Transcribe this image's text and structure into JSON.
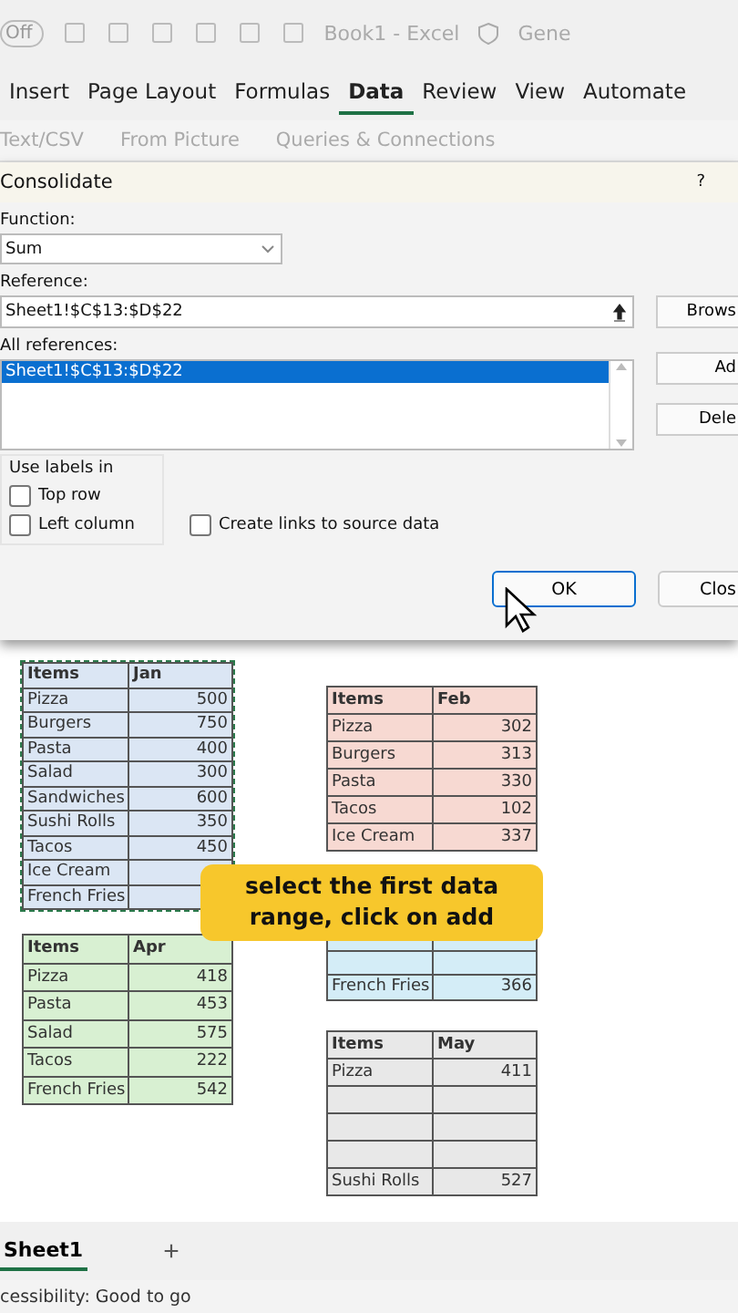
{
  "title_bar": {
    "autosave": "Off",
    "title": "Book1 - Excel",
    "sensitivity": "Gene"
  },
  "ribbon_tabs": [
    {
      "label": "Insert",
      "selected": false
    },
    {
      "label": "Page Layout",
      "selected": false
    },
    {
      "label": "Formulas",
      "selected": false
    },
    {
      "label": "Data",
      "selected": true
    },
    {
      "label": "Review",
      "selected": false
    },
    {
      "label": "View",
      "selected": false
    },
    {
      "label": "Automate",
      "selected": false
    }
  ],
  "ribbon": {
    "items": [
      "Text/CSV",
      "From Picture",
      "Queries & Connections"
    ]
  },
  "dialog": {
    "title": "Consolidate",
    "help": "?",
    "function_label": "Function:",
    "function_value": "Sum",
    "reference_label": "Reference:",
    "reference_value": "Sheet1!$C$13:$D$22",
    "all_references_label": "All references:",
    "all_references": [
      {
        "label": "Sheet1!$C$13:$D$22",
        "selected": true
      }
    ],
    "side_buttons": [
      "Brows",
      "Ad",
      "Dele"
    ],
    "use_labels_title": "Use labels in",
    "checkboxes": [
      {
        "label": "Top row",
        "checked": false
      },
      {
        "label": "Left column",
        "checked": false
      },
      {
        "label": "Create links to source data",
        "checked": false
      }
    ],
    "ok": "OK",
    "close": "Clos"
  },
  "sheet": {
    "left_column": [
      {
        "color": "#dbe6f4",
        "selected": true,
        "header": [
          "Items",
          "Jan"
        ],
        "rows": [
          {
            "kind": "row",
            "item": "Pizza",
            "value": "500"
          },
          {
            "kind": "row",
            "item": "Burgers",
            "value": "750"
          },
          {
            "kind": "row",
            "item": "Pasta",
            "value": "400"
          },
          {
            "kind": "row",
            "item": "Salad",
            "value": "300"
          },
          {
            "kind": "row",
            "item": "Sandwiches",
            "value": "600"
          },
          {
            "kind": "row",
            "item": "Sushi Rolls",
            "value": "350"
          },
          {
            "kind": "row",
            "item": "Tacos",
            "value": "450"
          },
          {
            "kind": "row",
            "item": "Ice Cream"
          },
          {
            "kind": "row",
            "item": "French Fries"
          }
        ]
      },
      {
        "color": "#d8f0d2",
        "selected": false,
        "header": [
          "Items",
          "Apr"
        ],
        "rows": [
          {
            "kind": "row",
            "item": "Pizza",
            "value": "418"
          },
          {
            "kind": "row",
            "item": "Pasta",
            "value": "453"
          },
          {
            "kind": "row",
            "item": "Salad",
            "value": "575"
          },
          {
            "kind": "row",
            "item": "Tacos",
            "value": "222"
          },
          {
            "kind": "row",
            "item": "French Fries",
            "value": "542"
          }
        ]
      }
    ],
    "right_column": [
      {
        "color": "#f7d9d2",
        "selected": false,
        "header": [
          "Items",
          "Feb"
        ],
        "rows": [
          {
            "kind": "row",
            "item": "Pizza",
            "value": "302"
          },
          {
            "kind": "row",
            "item": "Burgers",
            "value": "313"
          },
          {
            "kind": "row",
            "item": "Pasta",
            "value": "330"
          },
          {
            "kind": "row",
            "item": "Tacos",
            "value": "102"
          },
          {
            "kind": "row",
            "item": "Ice Cream",
            "value": "337"
          }
        ]
      },
      {
        "color": "#d4edf7",
        "selected": false,
        "rows": [
          {
            "kind": "blank"
          },
          {
            "kind": "blank"
          },
          {
            "kind": "row",
            "item": "French Fries",
            "value": "366"
          }
        ]
      },
      {
        "color": "#e8e8e8",
        "selected": false,
        "header": [
          "Items",
          "May"
        ],
        "rows": [
          {
            "kind": "row",
            "item": "Pizza",
            "value": "411"
          },
          {
            "kind": "blank"
          },
          {
            "kind": "blank"
          },
          {
            "kind": "blank"
          },
          {
            "kind": "row",
            "item": "Sushi Rolls",
            "value": "527"
          }
        ]
      }
    ]
  },
  "caption": "select the first data range, click on add",
  "sheet_tabs": [
    {
      "label": "Sheet1",
      "selected": true
    }
  ],
  "add_sheet": "+",
  "status_bar": "cessibility: Good to go"
}
